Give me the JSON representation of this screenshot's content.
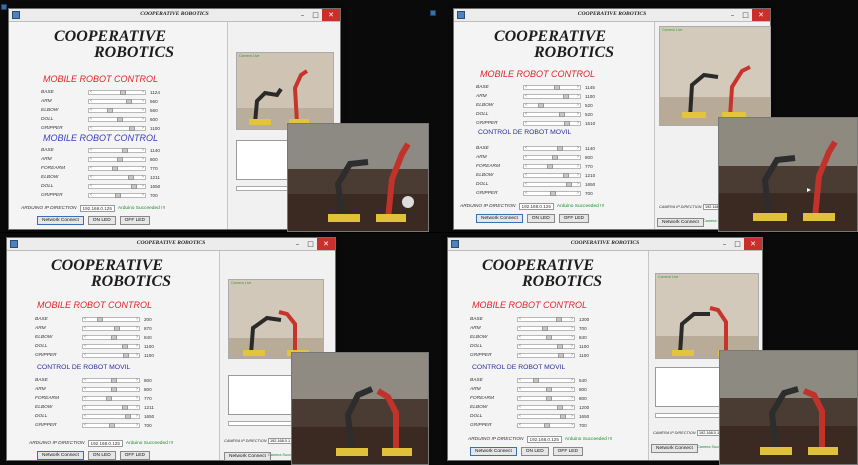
{
  "app": {
    "window_title": "COOPERATIVE ROBOTICS",
    "logo_line1": "COOPERATIVE",
    "logo_line2": "ROBOTICS",
    "window_controls": {
      "minimize": "–",
      "maximize": "□",
      "close": "✕"
    }
  },
  "section_mobile": "MOBILE ROBOT CONTROL",
  "section_mobile_alt": "MOBILE ROBOT CONTROL",
  "section_movil": "CONTROL DE ROBOT MOVIL",
  "section1_labels": [
    "BASE",
    "ARM",
    "ELBOW",
    "DOLL",
    "GRIPPER"
  ],
  "section2_labels": [
    "BASE",
    "ARM",
    "FOREARM",
    "ELBOW",
    "DOLL",
    "GRIPPER"
  ],
  "arduino": {
    "label": "ARDUINO IP DIRECTION",
    "ip": "192.168.0.125",
    "status": "Arduino Succeeded !!!"
  },
  "buttons": {
    "network_connect": "Network Connect",
    "on_led": "ON LED",
    "off_led": "OFF LED"
  },
  "side_panel": {
    "camera_label": "Camera Live",
    "camera_ip_label": "CAMERA IP DIRECTION",
    "camera_ip": "192.168.0.1",
    "network_connect": "Network Connect",
    "camera_status": "Camera Succeeded"
  },
  "quads": [
    {
      "section1_title_key": "mobile_alt",
      "section2_title": "MOBILE ROBOT CONTROL",
      "section1": [
        {
          "value": "1124",
          "pos": 0.62
        },
        {
          "value": "560",
          "pos": 0.78
        },
        {
          "value": "560",
          "pos": 0.3
        },
        {
          "value": "600",
          "pos": 0.55
        },
        {
          "value": "1100",
          "pos": 0.86
        }
      ],
      "section2": [
        {
          "value": "1140",
          "pos": 0.68
        },
        {
          "value": "800",
          "pos": 0.55
        },
        {
          "value": "770",
          "pos": 0.42
        },
        {
          "value": "1211",
          "pos": 0.82
        },
        {
          "value": "1650",
          "pos": 0.9
        },
        {
          "value": "700",
          "pos": 0.5
        }
      ]
    },
    {
      "section2_title": "CONTROL DE ROBOT MOVIL",
      "section1": [
        {
          "value": "1145",
          "pos": 0.6
        },
        {
          "value": "1100",
          "pos": 0.82
        },
        {
          "value": "520",
          "pos": 0.2
        },
        {
          "value": "520",
          "pos": 0.72
        },
        {
          "value": "1510",
          "pos": 0.86
        }
      ],
      "section2": [
        {
          "value": "1140",
          "pos": 0.68
        },
        {
          "value": "800",
          "pos": 0.55
        },
        {
          "value": "770",
          "pos": 0.42
        },
        {
          "value": "1210",
          "pos": 0.82
        },
        {
          "value": "1650",
          "pos": 0.9
        },
        {
          "value": "700",
          "pos": 0.5
        }
      ]
    },
    {
      "section2_title": "CONTROL DE ROBOT MOVIL",
      "section1": [
        {
          "value": "200",
          "pos": 0.2
        },
        {
          "value": "870",
          "pos": 0.62
        },
        {
          "value": "840",
          "pos": 0.56
        },
        {
          "value": "1100",
          "pos": 0.82
        },
        {
          "value": "1100",
          "pos": 0.86
        }
      ],
      "section2": [
        {
          "value": "800",
          "pos": 0.55
        },
        {
          "value": "800",
          "pos": 0.55
        },
        {
          "value": "770",
          "pos": 0.42
        },
        {
          "value": "1211",
          "pos": 0.82
        },
        {
          "value": "1650",
          "pos": 0.9
        },
        {
          "value": "700",
          "pos": 0.5
        }
      ]
    },
    {
      "section2_title": "CONTROL DE ROBOT MOVIL",
      "section1": [
        {
          "value": "1300",
          "pos": 0.8
        },
        {
          "value": "700",
          "pos": 0.45
        },
        {
          "value": "840",
          "pos": 0.56
        },
        {
          "value": "1100",
          "pos": 0.82
        },
        {
          "value": "1100",
          "pos": 0.86
        }
      ],
      "section2": [
        {
          "value": "540",
          "pos": 0.22
        },
        {
          "value": "800",
          "pos": 0.55
        },
        {
          "value": "800",
          "pos": 0.55
        },
        {
          "value": "1200",
          "pos": 0.82
        },
        {
          "value": "1650",
          "pos": 0.9
        },
        {
          "value": "700",
          "pos": 0.5
        }
      ]
    }
  ],
  "colors": {
    "mobile_title": "#e3242b",
    "movil_title": "#3b3dbb",
    "status_green": "#1a8b2a",
    "close_button": "#c9302c"
  }
}
